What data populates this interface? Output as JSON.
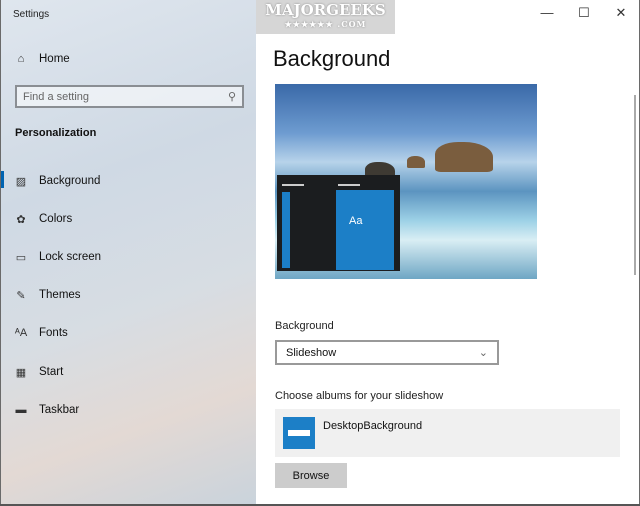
{
  "window": {
    "title": "Settings",
    "controls": {
      "minimize": "—",
      "maximize": "☐",
      "close": "✕"
    }
  },
  "watermark": {
    "text": "MAJORGEEKS",
    "sub": "★★★★★★ .COM"
  },
  "sidebar": {
    "home": "Home",
    "search": {
      "placeholder": "Find a setting"
    },
    "section": "Personalization",
    "items": [
      {
        "label": "Background",
        "icon": "picture-icon",
        "glyph": "🖼",
        "selected": true
      },
      {
        "label": "Colors",
        "icon": "palette-icon",
        "glyph": "🎨"
      },
      {
        "label": "Lock screen",
        "icon": "lock-screen-icon",
        "glyph": "▭"
      },
      {
        "label": "Themes",
        "icon": "themes-icon",
        "glyph": "✎"
      },
      {
        "label": "Fonts",
        "icon": "fonts-icon",
        "glyph": "ᴬA"
      },
      {
        "label": "Start",
        "icon": "start-icon",
        "glyph": "▦"
      },
      {
        "label": "Taskbar",
        "icon": "taskbar-icon",
        "glyph": "▭"
      }
    ]
  },
  "main": {
    "title": "Background",
    "preview_tile_text": "Aa",
    "background_label": "Background",
    "background_value": "Slideshow",
    "albums_label": "Choose albums for your slideshow",
    "album_name": "DesktopBackground",
    "browse": "Browse"
  },
  "colors": {
    "accent": "#0063b1",
    "tile": "#1c7fc7"
  }
}
